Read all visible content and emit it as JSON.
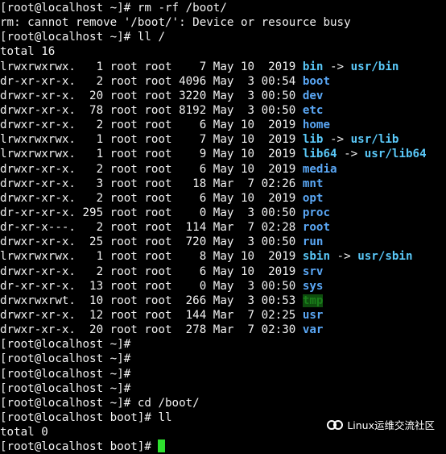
{
  "colors": {
    "background": "#000000",
    "text": "#f2f2f2",
    "symlink": "#5ac8f8",
    "directory": "#5aa7f5",
    "sticky_dir_fg": "#1a7f1a",
    "sticky_dir_bg": "#0e4d0e",
    "cursor": "#2ee02e"
  },
  "terminal": {
    "lines": [
      {
        "text": "[root@localhost ~]# rm -rf /boot/"
      },
      {
        "text": "rm: cannot remove '/boot/': Device or resource busy"
      },
      {
        "text": "[root@localhost ~]# ll /"
      },
      {
        "text": "total 16"
      }
    ],
    "listing": [
      {
        "prefix": "lrwxrwxrwx.   1 root root    7 May 10  2019 ",
        "name": "bin",
        "type": "link",
        "target": "usr/bin"
      },
      {
        "prefix": "dr-xr-xr-x.   2 root root 4096 May  3 00:54 ",
        "name": "boot",
        "type": "dir",
        "target": ""
      },
      {
        "prefix": "drwxr-xr-x.  20 root root 3220 May  3 00:50 ",
        "name": "dev",
        "type": "dir",
        "target": ""
      },
      {
        "prefix": "drwxr-xr-x.  78 root root 8192 May  3 00:50 ",
        "name": "etc",
        "type": "dir",
        "target": ""
      },
      {
        "prefix": "drwxr-xr-x.   2 root root    6 May 10  2019 ",
        "name": "home",
        "type": "dir",
        "target": ""
      },
      {
        "prefix": "lrwxrwxrwx.   1 root root    7 May 10  2019 ",
        "name": "lib",
        "type": "link",
        "target": "usr/lib"
      },
      {
        "prefix": "lrwxrwxrwx.   1 root root    9 May 10  2019 ",
        "name": "lib64",
        "type": "link",
        "target": "usr/lib64"
      },
      {
        "prefix": "drwxr-xr-x.   2 root root    6 May 10  2019 ",
        "name": "media",
        "type": "dir",
        "target": ""
      },
      {
        "prefix": "drwxr-xr-x.   3 root root   18 Mar  7 02:26 ",
        "name": "mnt",
        "type": "dir",
        "target": ""
      },
      {
        "prefix": "drwxr-xr-x.   2 root root    6 May 10  2019 ",
        "name": "opt",
        "type": "dir",
        "target": ""
      },
      {
        "prefix": "dr-xr-xr-x. 295 root root    0 May  3 00:50 ",
        "name": "proc",
        "type": "dir",
        "target": ""
      },
      {
        "prefix": "dr-xr-x---.   2 root root  114 Mar  7 02:28 ",
        "name": "root",
        "type": "dir",
        "target": ""
      },
      {
        "prefix": "drwxr-xr-x.  25 root root  720 May  3 00:50 ",
        "name": "run",
        "type": "dir",
        "target": ""
      },
      {
        "prefix": "lrwxrwxrwx.   1 root root    8 May 10  2019 ",
        "name": "sbin",
        "type": "link",
        "target": "usr/sbin"
      },
      {
        "prefix": "drwxr-xr-x.   2 root root    6 May 10  2019 ",
        "name": "srv",
        "type": "dir",
        "target": ""
      },
      {
        "prefix": "dr-xr-xr-x.  13 root root    0 May  3 00:50 ",
        "name": "sys",
        "type": "dir",
        "target": ""
      },
      {
        "prefix": "drwxrwxrwt.  10 root root  266 May  3 00:53 ",
        "name": "tmp",
        "type": "sticky",
        "target": ""
      },
      {
        "prefix": "drwxr-xr-x.  12 root root  144 Mar  7 02:25 ",
        "name": "usr",
        "type": "dir",
        "target": ""
      },
      {
        "prefix": "drwxr-xr-x.  20 root root  278 Mar  7 02:30 ",
        "name": "var",
        "type": "dir",
        "target": ""
      }
    ],
    "after_lines": [
      {
        "text": "[root@localhost ~]#"
      },
      {
        "text": "[root@localhost ~]#"
      },
      {
        "text": "[root@localhost ~]#"
      },
      {
        "text": "[root@localhost ~]#"
      },
      {
        "text": "[root@localhost ~]# cd /boot/"
      },
      {
        "text": "[root@localhost boot]# ll"
      },
      {
        "text": "total 0"
      }
    ],
    "arrow": " -> ",
    "final_prompt": "[root@localhost boot]# "
  },
  "watermark": {
    "text": "Linux运维交流社区",
    "icon": "wechat-channel-icon"
  }
}
